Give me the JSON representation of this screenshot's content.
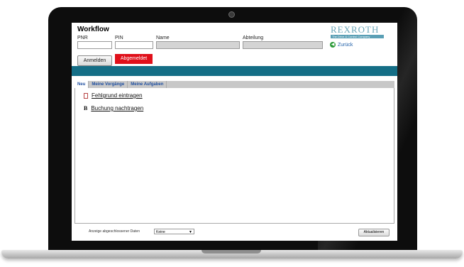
{
  "app": {
    "title": "Workflow"
  },
  "form": {
    "pnr_label": "PNR",
    "pin_label": "PIN",
    "name_label": "Name",
    "abteilung_label": "Abteilung",
    "pnr_value": "",
    "pin_value": "",
    "name_value": "",
    "abteilung_value": ""
  },
  "logo": {
    "text": "REXROTH",
    "subtext": "The Drive & Control Company"
  },
  "nav": {
    "back_label": "Zurück"
  },
  "buttons": {
    "login": "Anmelden",
    "logout": "Abgemeldet",
    "refresh": "Aktualisieren"
  },
  "tabs": [
    {
      "label": "Neu",
      "active": true
    },
    {
      "label": "Meine Vorgänge",
      "active": false
    },
    {
      "label": "Meine Aufgaben",
      "active": false
    }
  ],
  "items": [
    {
      "label": "Fehlgrund eintragen",
      "icon": "document-icon"
    },
    {
      "label": "Buchung nachtragen",
      "icon": "b-icon"
    }
  ],
  "footer": {
    "label": "Anzeige abgeschlossener Daten",
    "select_value": "Keine"
  },
  "colors": {
    "teal_bar": "#146e86",
    "logout_bg": "#e0101a",
    "tab_text": "#1f4fa0"
  }
}
